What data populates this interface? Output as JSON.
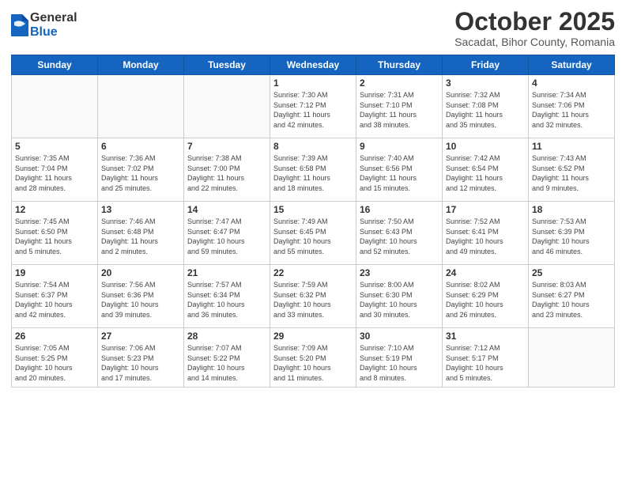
{
  "logo": {
    "general": "General",
    "blue": "Blue"
  },
  "title": "October 2025",
  "subtitle": "Sacadat, Bihor County, Romania",
  "days_of_week": [
    "Sunday",
    "Monday",
    "Tuesday",
    "Wednesday",
    "Thursday",
    "Friday",
    "Saturday"
  ],
  "weeks": [
    [
      {
        "day": "",
        "info": ""
      },
      {
        "day": "",
        "info": ""
      },
      {
        "day": "",
        "info": ""
      },
      {
        "day": "1",
        "info": "Sunrise: 7:30 AM\nSunset: 7:12 PM\nDaylight: 11 hours\nand 42 minutes."
      },
      {
        "day": "2",
        "info": "Sunrise: 7:31 AM\nSunset: 7:10 PM\nDaylight: 11 hours\nand 38 minutes."
      },
      {
        "day": "3",
        "info": "Sunrise: 7:32 AM\nSunset: 7:08 PM\nDaylight: 11 hours\nand 35 minutes."
      },
      {
        "day": "4",
        "info": "Sunrise: 7:34 AM\nSunset: 7:06 PM\nDaylight: 11 hours\nand 32 minutes."
      }
    ],
    [
      {
        "day": "5",
        "info": "Sunrise: 7:35 AM\nSunset: 7:04 PM\nDaylight: 11 hours\nand 28 minutes."
      },
      {
        "day": "6",
        "info": "Sunrise: 7:36 AM\nSunset: 7:02 PM\nDaylight: 11 hours\nand 25 minutes."
      },
      {
        "day": "7",
        "info": "Sunrise: 7:38 AM\nSunset: 7:00 PM\nDaylight: 11 hours\nand 22 minutes."
      },
      {
        "day": "8",
        "info": "Sunrise: 7:39 AM\nSunset: 6:58 PM\nDaylight: 11 hours\nand 18 minutes."
      },
      {
        "day": "9",
        "info": "Sunrise: 7:40 AM\nSunset: 6:56 PM\nDaylight: 11 hours\nand 15 minutes."
      },
      {
        "day": "10",
        "info": "Sunrise: 7:42 AM\nSunset: 6:54 PM\nDaylight: 11 hours\nand 12 minutes."
      },
      {
        "day": "11",
        "info": "Sunrise: 7:43 AM\nSunset: 6:52 PM\nDaylight: 11 hours\nand 9 minutes."
      }
    ],
    [
      {
        "day": "12",
        "info": "Sunrise: 7:45 AM\nSunset: 6:50 PM\nDaylight: 11 hours\nand 5 minutes."
      },
      {
        "day": "13",
        "info": "Sunrise: 7:46 AM\nSunset: 6:48 PM\nDaylight: 11 hours\nand 2 minutes."
      },
      {
        "day": "14",
        "info": "Sunrise: 7:47 AM\nSunset: 6:47 PM\nDaylight: 10 hours\nand 59 minutes."
      },
      {
        "day": "15",
        "info": "Sunrise: 7:49 AM\nSunset: 6:45 PM\nDaylight: 10 hours\nand 55 minutes."
      },
      {
        "day": "16",
        "info": "Sunrise: 7:50 AM\nSunset: 6:43 PM\nDaylight: 10 hours\nand 52 minutes."
      },
      {
        "day": "17",
        "info": "Sunrise: 7:52 AM\nSunset: 6:41 PM\nDaylight: 10 hours\nand 49 minutes."
      },
      {
        "day": "18",
        "info": "Sunrise: 7:53 AM\nSunset: 6:39 PM\nDaylight: 10 hours\nand 46 minutes."
      }
    ],
    [
      {
        "day": "19",
        "info": "Sunrise: 7:54 AM\nSunset: 6:37 PM\nDaylight: 10 hours\nand 42 minutes."
      },
      {
        "day": "20",
        "info": "Sunrise: 7:56 AM\nSunset: 6:36 PM\nDaylight: 10 hours\nand 39 minutes."
      },
      {
        "day": "21",
        "info": "Sunrise: 7:57 AM\nSunset: 6:34 PM\nDaylight: 10 hours\nand 36 minutes."
      },
      {
        "day": "22",
        "info": "Sunrise: 7:59 AM\nSunset: 6:32 PM\nDaylight: 10 hours\nand 33 minutes."
      },
      {
        "day": "23",
        "info": "Sunrise: 8:00 AM\nSunset: 6:30 PM\nDaylight: 10 hours\nand 30 minutes."
      },
      {
        "day": "24",
        "info": "Sunrise: 8:02 AM\nSunset: 6:29 PM\nDaylight: 10 hours\nand 26 minutes."
      },
      {
        "day": "25",
        "info": "Sunrise: 8:03 AM\nSunset: 6:27 PM\nDaylight: 10 hours\nand 23 minutes."
      }
    ],
    [
      {
        "day": "26",
        "info": "Sunrise: 7:05 AM\nSunset: 5:25 PM\nDaylight: 10 hours\nand 20 minutes."
      },
      {
        "day": "27",
        "info": "Sunrise: 7:06 AM\nSunset: 5:23 PM\nDaylight: 10 hours\nand 17 minutes."
      },
      {
        "day": "28",
        "info": "Sunrise: 7:07 AM\nSunset: 5:22 PM\nDaylight: 10 hours\nand 14 minutes."
      },
      {
        "day": "29",
        "info": "Sunrise: 7:09 AM\nSunset: 5:20 PM\nDaylight: 10 hours\nand 11 minutes."
      },
      {
        "day": "30",
        "info": "Sunrise: 7:10 AM\nSunset: 5:19 PM\nDaylight: 10 hours\nand 8 minutes."
      },
      {
        "day": "31",
        "info": "Sunrise: 7:12 AM\nSunset: 5:17 PM\nDaylight: 10 hours\nand 5 minutes."
      },
      {
        "day": "",
        "info": ""
      }
    ]
  ]
}
